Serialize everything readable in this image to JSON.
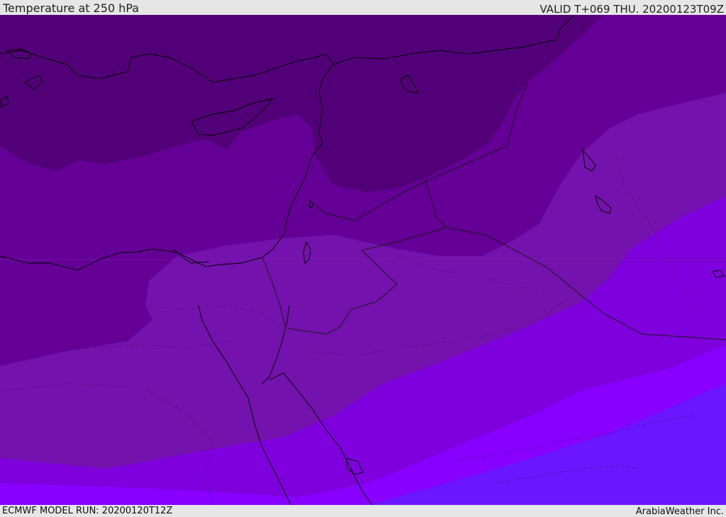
{
  "header": {
    "title": "Temperature at 250 hPa",
    "valid": "VALID T+069 THU. 20200123T09Z"
  },
  "footer": {
    "model_run": "ECMWF MODEL RUN: 20200120T12Z",
    "credit": "ArabiaWeather Inc."
  },
  "colors": {
    "band_1_coldest": "#520078",
    "band_2": "#640096",
    "band_3": "#7412ad",
    "band_4": "#7e00dc",
    "band_5": "#8800ff",
    "band_6_warmest": "#6a16ff",
    "coastline": "#000000",
    "border": "#1a1a1a",
    "panel": "#e6e6e6"
  },
  "map": {
    "field": "temperature",
    "level": "250 hPa",
    "projection": "lat-lon",
    "region": "Eastern Mediterranean / Middle East"
  }
}
